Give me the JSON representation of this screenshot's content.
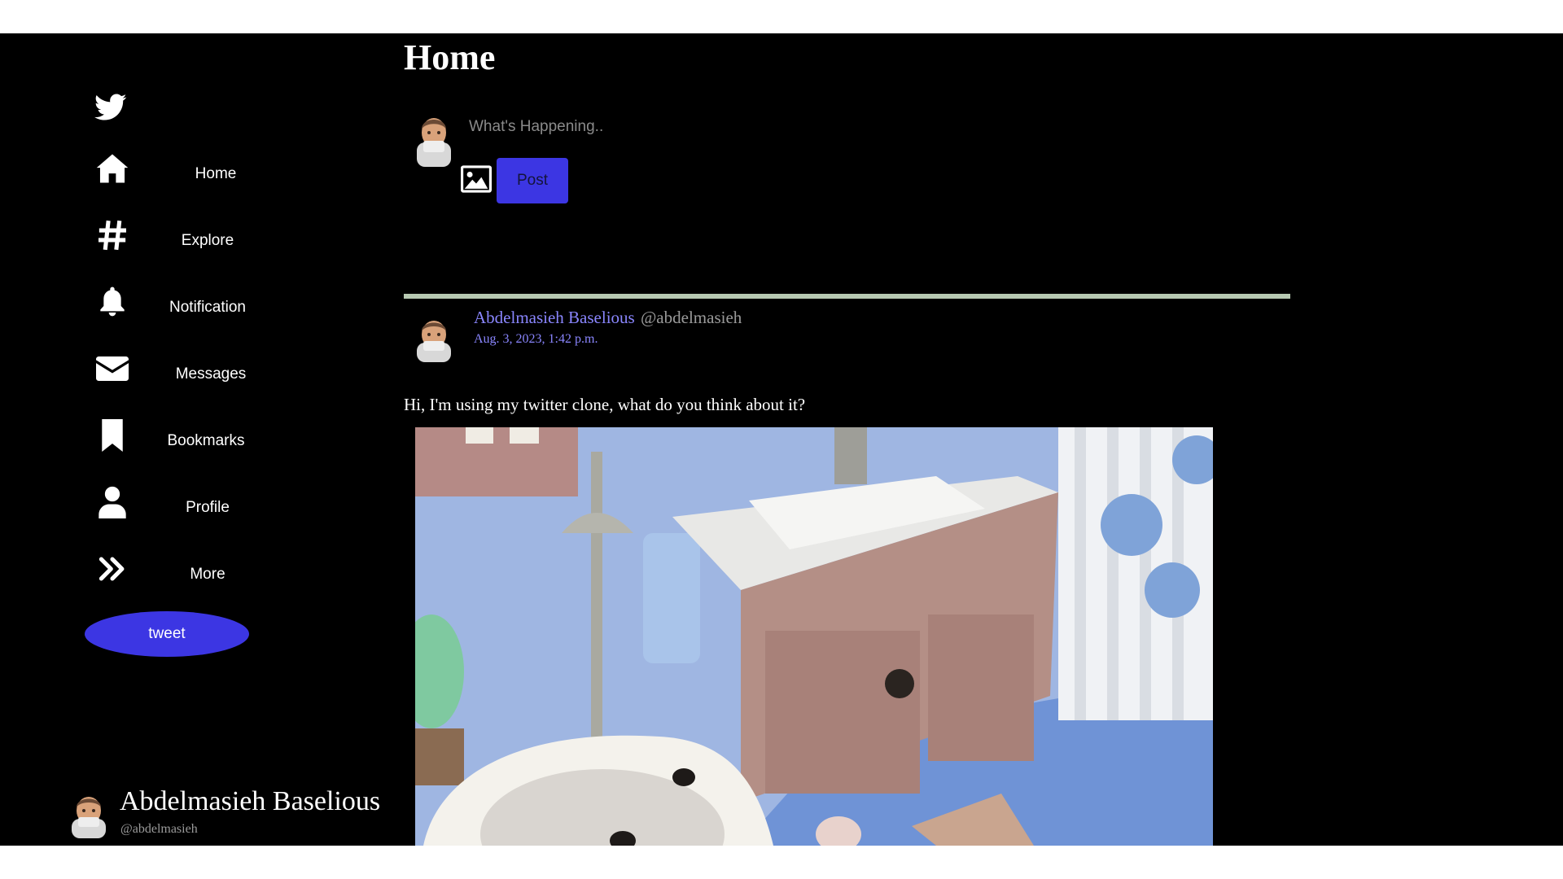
{
  "sidebar": {
    "logo_icon": "twitter-bird-icon",
    "items": [
      {
        "label": "Home",
        "icon": "home-icon"
      },
      {
        "label": "Explore",
        "icon": "hashtag-icon"
      },
      {
        "label": "Notification",
        "icon": "bell-icon"
      },
      {
        "label": "Messages",
        "icon": "envelope-icon"
      },
      {
        "label": "Bookmarks",
        "icon": "bookmark-icon"
      },
      {
        "label": "Profile",
        "icon": "user-icon"
      },
      {
        "label": "More",
        "icon": "double-chevron-right-icon"
      }
    ],
    "tweet_label": "tweet",
    "account": {
      "name": "Abdelmasieh Baselious",
      "handle": "@abdelmasieh"
    }
  },
  "main": {
    "title": "Home",
    "composer": {
      "placeholder": "What's Happening..",
      "image_icon": "image-icon",
      "post_label": "Post"
    },
    "post": {
      "author": "Abdelmasieh Baselious",
      "handle": "@abdelmasieh",
      "date": "Aug. 3, 2023, 1:42 p.m.",
      "text": "Hi, I'm using my twitter clone, what do you think about it?"
    }
  },
  "colors": {
    "background": "#000000",
    "accent": "#3c36e3",
    "link": "#8a86ff",
    "divider": "#b7c9b2",
    "muted": "#9a9a9a"
  }
}
